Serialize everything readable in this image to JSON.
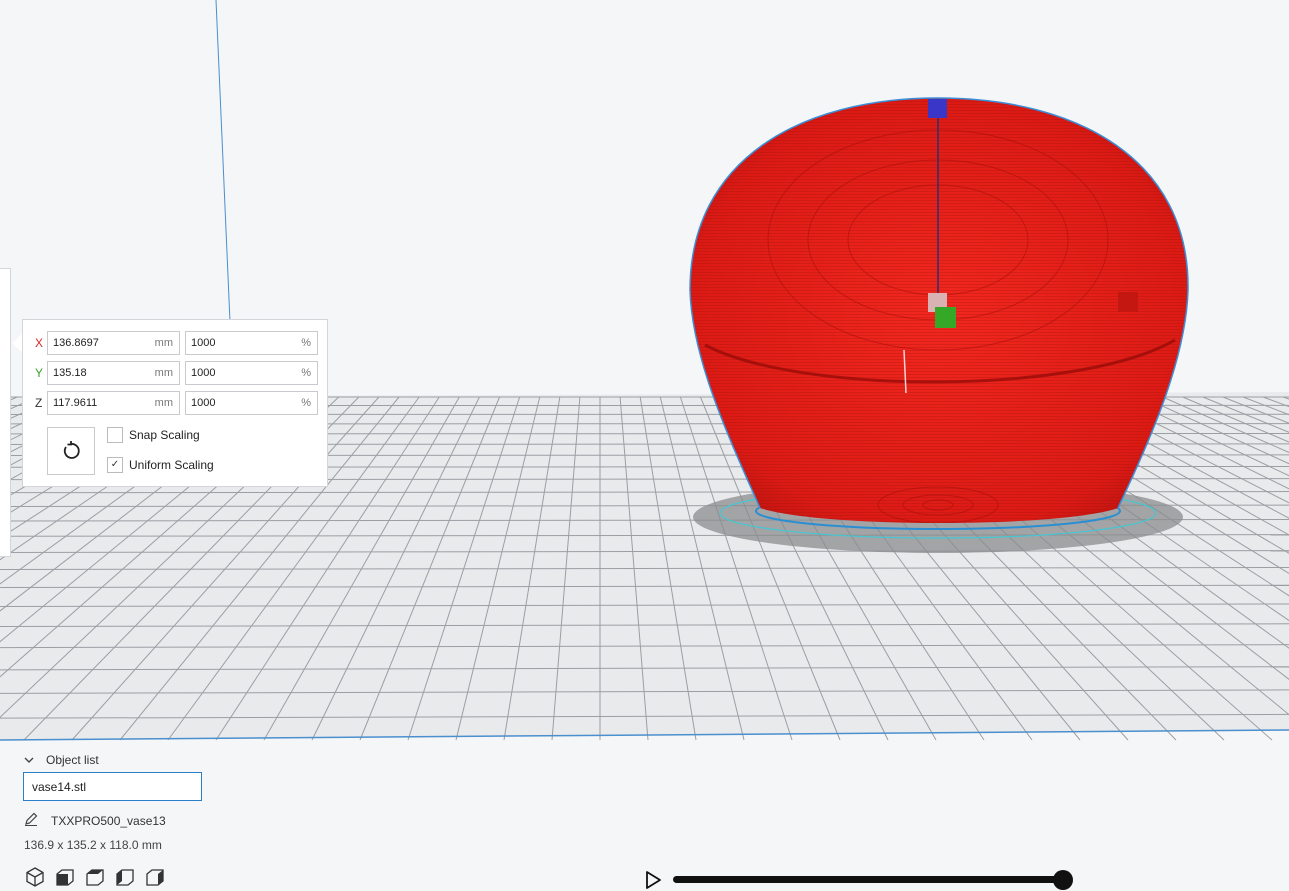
{
  "scale_panel": {
    "rows": [
      {
        "axis": "X",
        "mm": "136.8697",
        "mm_unit": "mm",
        "percent": "1000",
        "percent_unit": "%"
      },
      {
        "axis": "Y",
        "mm": "135.18",
        "mm_unit": "mm",
        "percent": "1000",
        "percent_unit": "%"
      },
      {
        "axis": "Z",
        "mm": "117.9611",
        "mm_unit": "mm",
        "percent": "1000",
        "percent_unit": "%"
      }
    ],
    "snap_scaling": {
      "label": "Snap Scaling",
      "checked": false,
      "mark": ""
    },
    "uniform_scaling": {
      "label": "Uniform Scaling",
      "checked": true,
      "mark": "✓"
    }
  },
  "object_list": {
    "header": "Object list",
    "selected_object": "vase14.stl",
    "job_name": "TXXPRO500_vase13",
    "dimensions": "136.9 x 135.2 x 118.0 mm"
  },
  "view_buttons": [
    "3d-view-icon",
    "front-view-icon",
    "top-view-icon",
    "left-view-icon",
    "right-view-icon"
  ],
  "layer_slider": {
    "position": 1.0
  },
  "colors": {
    "model": "#e8231c",
    "model_outline": "#3b8fd9",
    "build_plate": "#e9eaec",
    "grid_line": "#9b9ea3",
    "accent": "#2a7fc9"
  }
}
